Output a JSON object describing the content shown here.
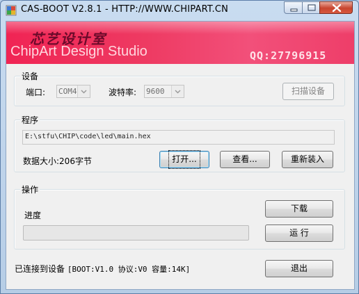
{
  "window": {
    "title": "CAS-BOOT V2.8.1 - HTTP://WWW.CHIPART.CN",
    "app_icon": "chip-app-icon",
    "controls": [
      "minimize-icon",
      "maximize-icon",
      "close-icon"
    ]
  },
  "banner": {
    "cn_text": "芯艺设计室",
    "en_text": "ChipArt Design Studio",
    "qq_text": "QQ:27796915"
  },
  "device_group": {
    "title": "设备",
    "port_label": "端口:",
    "port_value": "COM4",
    "baud_label": "波特率:",
    "baud_value": "9600",
    "scan_button": "扫描设备"
  },
  "program_group": {
    "title": "程序",
    "file_path": "E:\\stfu\\CHIP\\code\\led\\main.hex",
    "data_size": "数据大小:206字节",
    "open_button": "打开...",
    "view_button": "查看...",
    "reload_button": "重新装入"
  },
  "operation_group": {
    "title": "操作",
    "progress_label": "进度",
    "progress_value": 0,
    "download_button": "下载",
    "run_button": "运 行"
  },
  "status": {
    "text": "已连接到设备",
    "details": "[BOOT:V1.0 协议:V0 容量:14K]"
  },
  "exit_button": "退出",
  "colors": {
    "banner": "#EE3A62",
    "close_button": "#C8452F",
    "window_frame": "#B9D1EA"
  }
}
